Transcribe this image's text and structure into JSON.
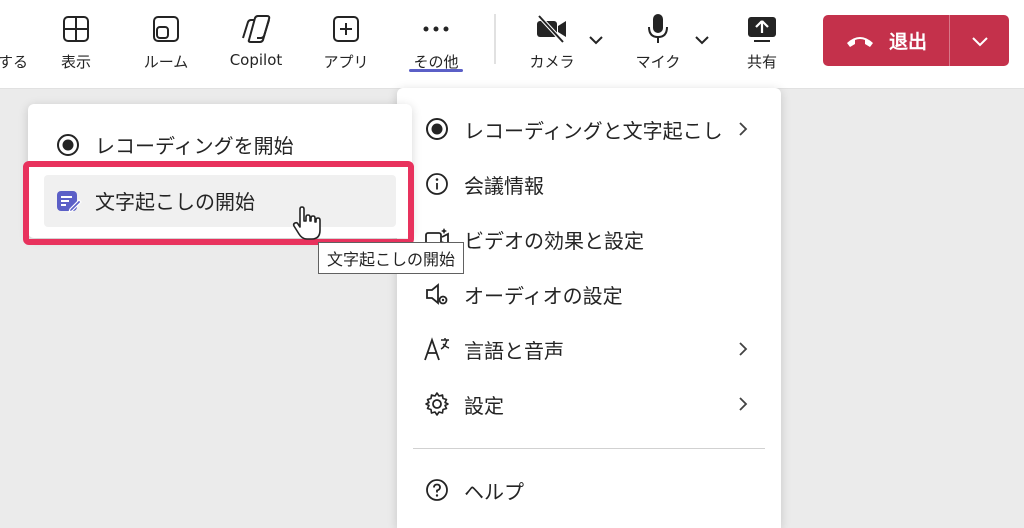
{
  "toolbar": {
    "partial_label": "する",
    "view_label": "表示",
    "rooms_label": "ルーム",
    "copilot_label": "Copilot",
    "apps_label": "アプリ",
    "more_label": "その他",
    "camera_label": "カメラ",
    "mic_label": "マイク",
    "share_label": "共有",
    "leave_label": "退出"
  },
  "more_menu": {
    "items": [
      {
        "label": "レコーディングと文字起こし",
        "icon": "record-icon",
        "has_submenu": true
      },
      {
        "label": "会議情報",
        "icon": "info-icon",
        "has_submenu": false
      },
      {
        "label": "ビデオの効果と設定",
        "icon": "video-effects-icon",
        "has_submenu": false
      },
      {
        "label": "オーディオの設定",
        "icon": "audio-settings-icon",
        "has_submenu": false
      },
      {
        "label": "言語と音声",
        "icon": "language-icon",
        "has_submenu": true
      },
      {
        "label": "設定",
        "icon": "gear-icon",
        "has_submenu": true
      },
      {
        "label": "ヘルプ",
        "icon": "help-icon",
        "has_submenu": false
      }
    ]
  },
  "submenu": {
    "start_recording": "レコーディングを開始",
    "start_transcription": "文字起こしの開始"
  },
  "tooltip": "文字起こしの開始",
  "colors": {
    "leave_red": "#c4314b",
    "accent": "#5b5fc7",
    "highlight": "#e8325d"
  }
}
